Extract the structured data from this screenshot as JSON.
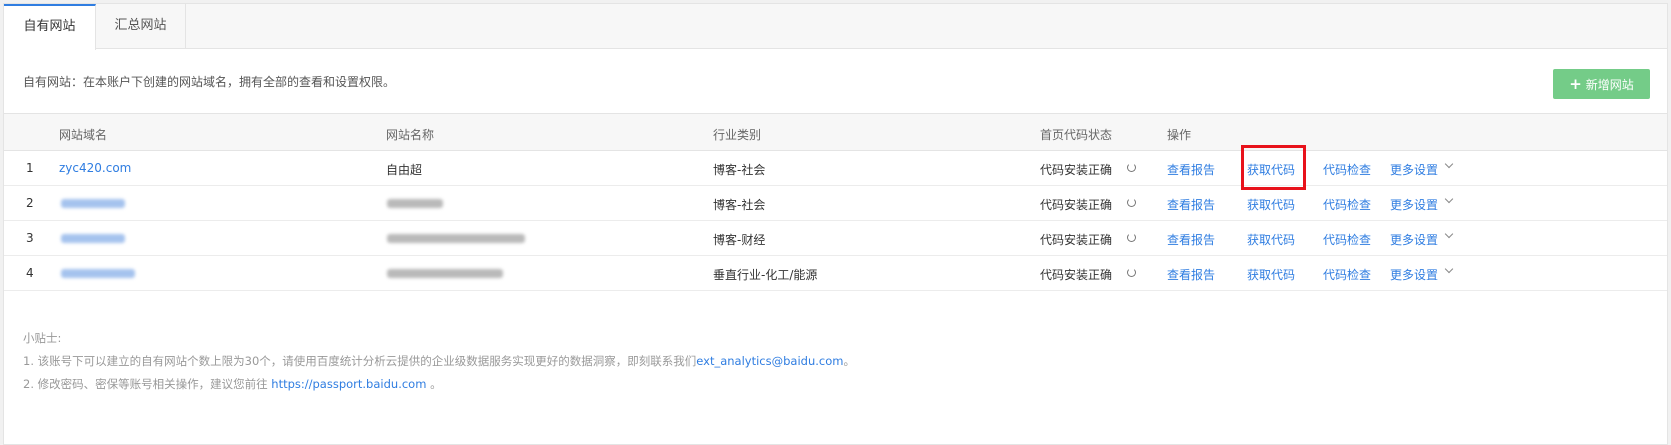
{
  "tabs": [
    {
      "label": "自有网站",
      "active": true
    },
    {
      "label": "汇总网站",
      "active": false
    }
  ],
  "info_text": "自有网站：在本账户下创建的网站域名，拥有全部的查看和设置权限。",
  "add_button": {
    "icon": "plus-icon",
    "label": "新增网站"
  },
  "table": {
    "headers": [
      "网站域名",
      "网站名称",
      "行业类别",
      "首页代码状态",
      "操作"
    ],
    "rows": [
      {
        "index": "1",
        "domain": "zyc420.com",
        "name": "自由超",
        "industry": "博客-社会",
        "status": "代码安装正确"
      },
      {
        "index": "2",
        "domain": "",
        "name": "",
        "industry": "博客-社会",
        "status": "代码安装正确"
      },
      {
        "index": "3",
        "domain": "",
        "name": "",
        "industry": "博客-财经",
        "status": "代码安装正确"
      },
      {
        "index": "4",
        "domain": "",
        "name": "",
        "industry": "垂直行业-化工/能源",
        "status": "代码安装正确"
      }
    ],
    "actions": {
      "view_report": "查看报告",
      "get_code": "获取代码",
      "check_code": "代码检查",
      "more_settings": "更多设置"
    }
  },
  "tips": {
    "title": "小贴士:",
    "line1_prefix": "1. 该账号下可以建立的自有网站个数上限为30个，请使用百度统计分析云提供的企业级数据服务实现更好的数据洞察，即刻联系我们",
    "line1_email": "ext_analytics@baidu.com",
    "line1_suffix": "。",
    "line2_prefix": "2. 修改密码、密保等账号相关操作，建议您前往 ",
    "line2_link": "https://passport.baidu.com",
    "line2_suffix": " 。"
  },
  "colors": {
    "accent": "#2f7de1",
    "add_button": "#74cc88",
    "highlight": "#e8121b"
  }
}
